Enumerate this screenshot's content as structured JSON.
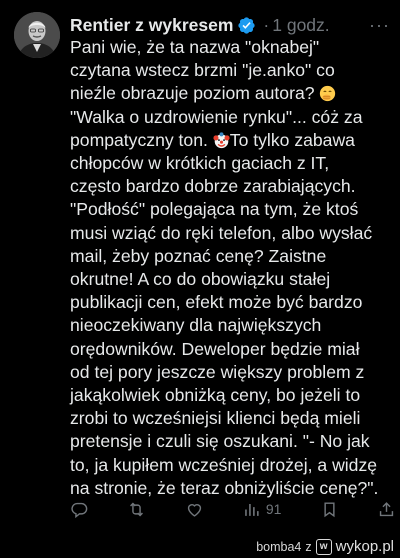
{
  "post": {
    "author_name": "Rentier z wykresem",
    "separator": "·",
    "time": "1 godz.",
    "more": "···",
    "text_lines": [
      "Pani wie, że ta nazwa \"oknabej\"",
      "czytana wstecz brzmi \"je.anko\" co",
      "nieźle obrazuje poziom autora? ",
      "\"Walka o uzdrowienie rynku\"... cóż za",
      "pompatyczny ton. ",
      "To tylko zabawa",
      "chłopców w krótkich gaciach z IT,",
      "często bardzo dobrze zarabiających.",
      "\"Podłość\" polegająca na tym, że ktoś",
      "musi wziąć do ręki telefon, albo wysłać",
      "mail, żeby poznać cenę? Zaistne",
      "okrutne! A co do obowiązku stałej",
      "publikacji cen, efekt może być bardzo",
      "nieoczekiwany dla największych",
      "orędowników. Deweloper będzie miał",
      "od tej pory jeszcze większy problem z",
      "jakąkolwiek obniżką ceny, bo jeżeli to",
      "zrobi to wcześniejsi klienci będą mieli",
      "pretensje i czuli się oszukani. \"- No jak",
      "to, ja kupiłem wcześniej drożej, a widzę",
      "na stronie, że teraz obniżyliście cenę?\"."
    ],
    "emojis": [
      "face-with-hand-over-mouth",
      "clown-face"
    ],
    "views_count": "91",
    "verified_color": "#1d9bf0"
  },
  "actions": [
    {
      "name": "reply-icon"
    },
    {
      "name": "retweet-icon"
    },
    {
      "name": "like-icon"
    },
    {
      "name": "views-icon",
      "label": "91"
    },
    {
      "name": "bookmark-icon"
    },
    {
      "name": "share-icon"
    }
  ],
  "watermark": {
    "user": "bomba4",
    "sep": "z",
    "logo_letter": "w",
    "site": "wykop.pl"
  }
}
